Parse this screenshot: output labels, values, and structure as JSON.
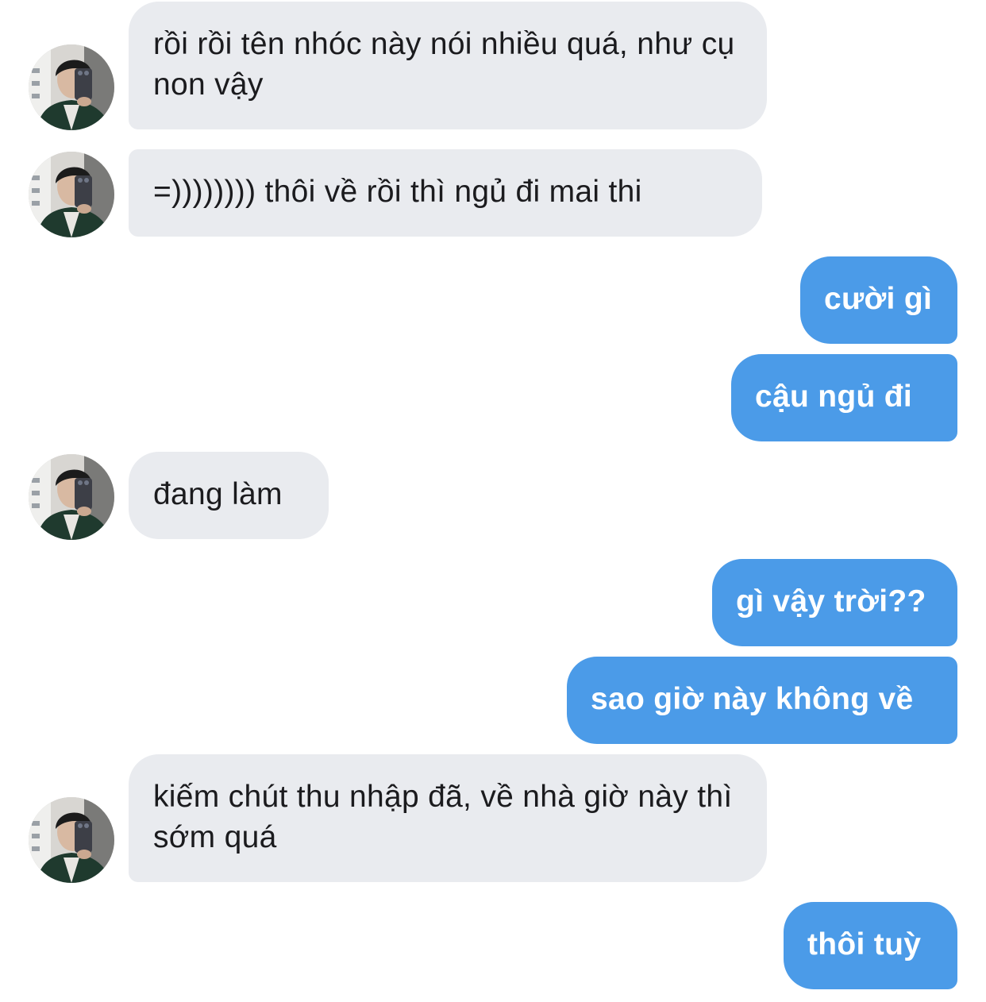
{
  "conversation": {
    "messages": [
      {
        "direction": "incoming",
        "text": "rồi rồi tên nhóc này nói nhiều quá, như cụ non vậy"
      },
      {
        "direction": "incoming",
        "text": "=)))))))) thôi về rồi thì ngủ đi mai thi"
      },
      {
        "direction": "outgoing",
        "text": "cười gì"
      },
      {
        "direction": "outgoing",
        "text": "cậu ngủ đi"
      },
      {
        "direction": "incoming",
        "text": "đang làm"
      },
      {
        "direction": "outgoing",
        "text": "gì vậy trời??"
      },
      {
        "direction": "outgoing",
        "text": "sao giờ này không về"
      },
      {
        "direction": "incoming",
        "text": "kiếm chút thu nhập đã, về nhà giờ này thì sớm quá"
      },
      {
        "direction": "outgoing",
        "text": "thôi tuỳ"
      }
    ]
  },
  "colors": {
    "incoming_bubble": "#e9ebef",
    "incoming_text": "#1b1b1e",
    "outgoing_bubble": "#4b9be8",
    "outgoing_text": "#ffffff",
    "background": "#ffffff"
  },
  "icons": {
    "avatar": "contact-avatar-photo"
  }
}
